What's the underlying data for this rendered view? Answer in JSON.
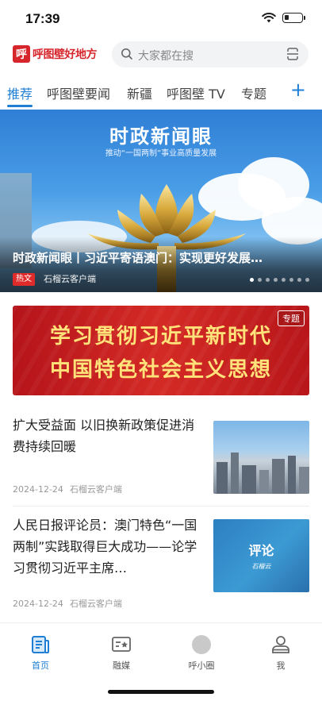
{
  "status_bar": {
    "time": "17:39"
  },
  "header": {
    "logo_mark": "呼",
    "logo_text": "呼图壁好地方",
    "search_placeholder": "大家都在搜"
  },
  "tabs": [
    {
      "label": "推荐",
      "active": true
    },
    {
      "label": "呼图壁要闻",
      "active": false
    },
    {
      "label": "新疆",
      "active": false
    },
    {
      "label": "呼图壁 TV",
      "active": false
    },
    {
      "label": "专题",
      "active": false
    }
  ],
  "tab_add": "+",
  "hero": {
    "banner_title": "时政新闻眼",
    "banner_subtitle": "推动“一国两制”事业高质量发展",
    "caption": "时政新闻眼丨习近平寄语澳门：实现更好发展…",
    "tag": "热文",
    "source": "石榴云客户端",
    "slide_count": 8,
    "active_slide": 0
  },
  "topic_banner": {
    "line1": "学习贯彻习近平新时代",
    "line2": "中国特色社会主义思想",
    "tag": "专题"
  },
  "news": [
    {
      "title": "扩大受益面 以旧换新政策促进消费持续回暖",
      "date": "2024-12-24",
      "source": "石榴云客户端",
      "thumb": "city-photo"
    },
    {
      "title": "人民日报评论员：澳门特色“一国两制”实践取得巨大成功——论学习贯彻习近平主席…",
      "date": "2024-12-24",
      "source": "石榴云客户端",
      "thumb": "commentary-card",
      "thumb_text": "评论",
      "thumb_sign": "石榴云"
    }
  ],
  "bottom_nav": [
    {
      "label": "首页",
      "icon": "home-news-icon",
      "active": true
    },
    {
      "label": "融媒",
      "icon": "media-icon",
      "active": false
    },
    {
      "label": "呼小圈",
      "icon": "circle-icon",
      "active": false
    },
    {
      "label": "我",
      "icon": "profile-icon",
      "active": false
    }
  ],
  "colors": {
    "accent": "#1f7fd4",
    "brand_red": "#d6262c",
    "hot_tag": "#e02b2b"
  }
}
